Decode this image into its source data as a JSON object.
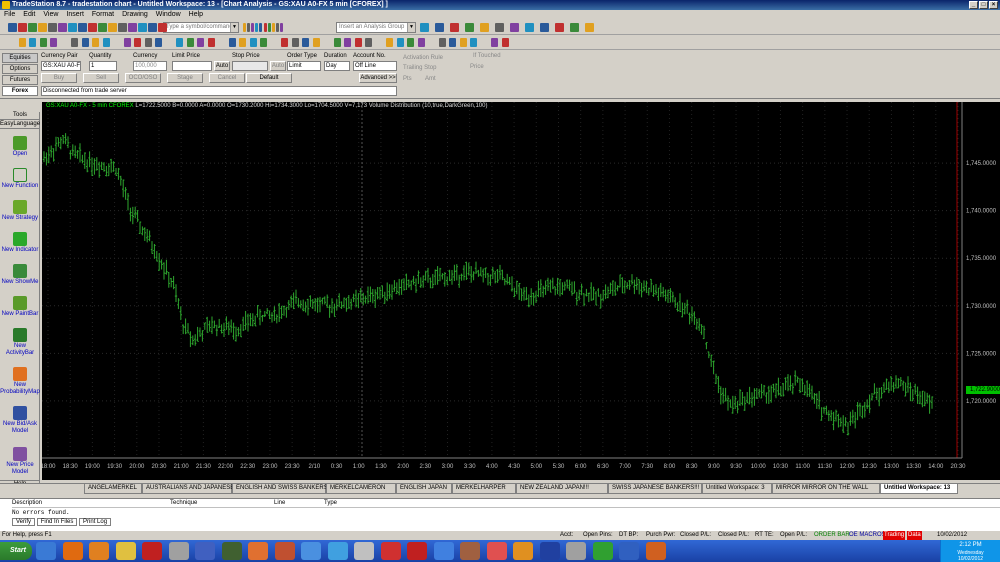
{
  "window": {
    "title": "TradeStation 8.7 - tradestation chart - Untitled Workspace: 13 - [Chart Analysis - GS:XAU A0-FX 5 min [CFOREX] ]",
    "min": "_",
    "max": "□",
    "close": "×"
  },
  "menu": [
    "File",
    "Edit",
    "View",
    "Insert",
    "Format",
    "Drawing",
    "Window",
    "Help"
  ],
  "toolbar": {
    "symbol_placeholder": "Type a symbol/command",
    "analysis_group_placeholder": "Insert an Analysis Group"
  },
  "asset_tabs": [
    "Equities",
    "Options",
    "Futures",
    "Forex"
  ],
  "order": {
    "currency_pair_label": "Currency Pair",
    "currency_pair": "GS:XAU A0-F",
    "quantity_label": "Quantity",
    "quantity": "1",
    "currency_label": "Currency",
    "currency": "100,000",
    "limit_price_label": "Limit Price",
    "auto": "Auto",
    "stop_price_label": "Stop Price",
    "auto2": "Auto",
    "order_type_label": "Order Type",
    "order_type": "Limit",
    "duration_label": "Duration",
    "duration": "Day",
    "account_label": "Account No.",
    "account": "Off Line",
    "buy": "Buy",
    "sell": "Sell",
    "oco": "OCO/OSO",
    "stage": "Stage",
    "cancel": "Cancel",
    "default": "Default",
    "advanced": "Advanced >>",
    "activation_rule": "Activation Rule",
    "trailing_stop": "Trailing Stop",
    "if_touched": "If Touched",
    "price": "Price",
    "pts": "Pts",
    "amt": "Amt",
    "message": "Disconnected from trade server"
  },
  "toolbox": {
    "title": "Tools",
    "easylanguage": "EasyLanguage",
    "items": [
      "Open",
      "New Function",
      "New Strategy",
      "New Indicator",
      "New ShowMe",
      "New PaintBar",
      "New ActivityBar",
      "New ProbabilityMap",
      "New Bid/Ask Model",
      "New Price Model"
    ],
    "help": "Help"
  },
  "chart": {
    "header": "GS:XAU A0-FX - 5 min  CFOREX",
    "header_stats": "L=1722.5000  B=0.0000  A=0.0000  O=1730.2000  Hi=1734.3000  Lo=1704.5000  V=7,173  Volume Distribution (10,true,DarkGreen,100)",
    "last_price": "1,722.9000",
    "price_colors": {
      "bar": "#2ea82e",
      "grid": "#555555",
      "header": "#00ff00",
      "last_bg": "#00c000"
    }
  },
  "chart_data": {
    "type": "ohlc",
    "ylim": [
      1714,
      1751
    ],
    "y_ticks": [
      1720,
      1725,
      1730,
      1735,
      1740,
      1745
    ],
    "y_tick_labels": [
      "1,720.0000",
      "1,725.0000",
      "1,730.0000",
      "1,735.0000",
      "1,740.0000",
      "1,745.0000"
    ],
    "x_tick_labels": [
      "18:00",
      "18:30",
      "19:00",
      "19:30",
      "20:00",
      "20:30",
      "21:00",
      "21:30",
      "22:00",
      "22:30",
      "23:00",
      "23:30",
      "2/10",
      "0:30",
      "1:00",
      "1:30",
      "2:00",
      "2:30",
      "3:00",
      "3:30",
      "4:00",
      "4:30",
      "5:00",
      "5:30",
      "6:00",
      "6:30",
      "7:00",
      "7:30",
      "8:00",
      "8:30",
      "9:00",
      "9:30",
      "10:00",
      "10:30",
      "11:00",
      "11:30",
      "12:00",
      "12:30",
      "13:00",
      "13:30",
      "14:00",
      "20:30"
    ],
    "keypoints": [
      [
        0,
        1745.5
      ],
      [
        8,
        1747.5
      ],
      [
        12,
        1746
      ],
      [
        20,
        1745
      ],
      [
        30,
        1744.5
      ],
      [
        36,
        1740
      ],
      [
        46,
        1736
      ],
      [
        54,
        1732
      ],
      [
        58,
        1728
      ],
      [
        62,
        1726.5
      ],
      [
        70,
        1728
      ],
      [
        80,
        1727.5
      ],
      [
        90,
        1729
      ],
      [
        96,
        1729
      ],
      [
        106,
        1730.5
      ],
      [
        118,
        1730
      ],
      [
        130,
        1730.5
      ],
      [
        142,
        1731.5
      ],
      [
        155,
        1732.5
      ],
      [
        168,
        1733
      ],
      [
        175,
        1733.5
      ],
      [
        190,
        1733
      ],
      [
        200,
        1731
      ],
      [
        215,
        1732
      ],
      [
        230,
        1731
      ],
      [
        245,
        1732.5
      ],
      [
        260,
        1731
      ],
      [
        268,
        1729.5
      ],
      [
        274,
        1728
      ],
      [
        278,
        1724
      ],
      [
        282,
        1721
      ],
      [
        286,
        1719.5
      ],
      [
        295,
        1720.5
      ],
      [
        305,
        1721
      ],
      [
        315,
        1722
      ],
      [
        325,
        1719
      ],
      [
        335,
        1717.5
      ],
      [
        345,
        1720.5
      ],
      [
        355,
        1722
      ],
      [
        362,
        1721
      ],
      [
        370,
        1719.5
      ]
    ],
    "bar_count": 375
  },
  "workspace_tabs": [
    "ANGELAMERKEL",
    "AUSTRALIANS AND JAPANESE",
    "ENGLISH AND SWISS BANKERS",
    "MERKELCAMERON",
    "ENGLISH JAPAN",
    "MERKELHARPER",
    "NEW ZEALAND JAPAN!!!",
    "SWISS JAPANESE BANKERS!!!",
    "Untitled Workspace: 3",
    "MIRROR MIRROR ON THE WALL",
    "Untitled Workspace: 13"
  ],
  "output": {
    "columns": [
      "Description",
      "Technique",
      "Line",
      "Type"
    ],
    "message": "No errors found.",
    "tabs": [
      "Verify",
      "Find In Files",
      "Print Log"
    ]
  },
  "statusbar": {
    "help": "For Help, press F1",
    "acct": "Acct:",
    "open_pins": "Open Pins:",
    "dt_bp": "DT BP:",
    "purch_pwr": "Purch Pwr:",
    "closed_pl": "Closed P/L:",
    "closed_pl2": "Closed P/L:",
    "rt_te": "RT TE:",
    "open_pl": "Open P/L:",
    "order_bar": "ORDER BAR",
    "oe_macros": "OE MACROS",
    "trading": "Trading",
    "data": "Data",
    "date": "10/02/2012"
  },
  "taskbar": {
    "start": "Start",
    "time": "2:12 PM",
    "day": "Wednesday",
    "date": "10/02/2012"
  }
}
